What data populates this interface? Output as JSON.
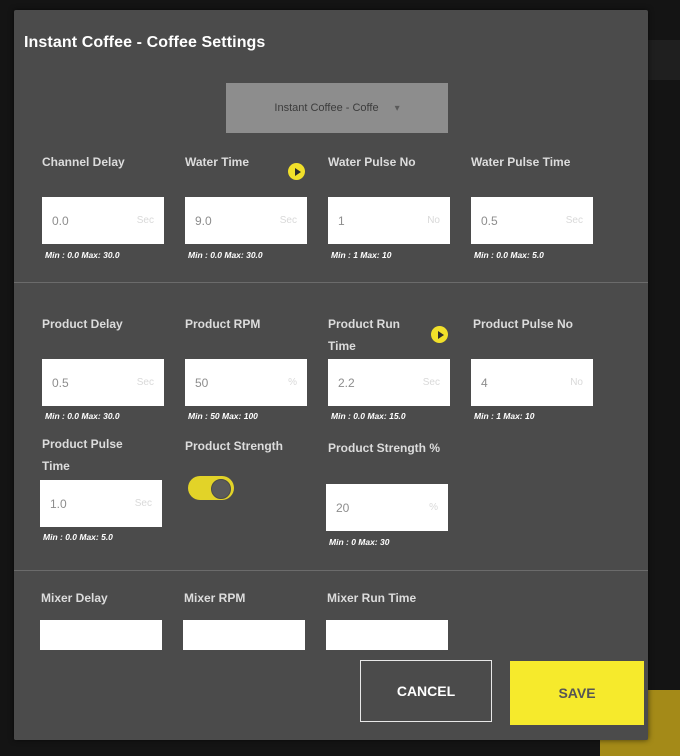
{
  "dialog": {
    "title": "Instant Coffee - Coffee Settings",
    "select_value": "Instant Coffee - Coffe"
  },
  "fields": {
    "channel_delay": {
      "label": "Channel Delay",
      "value": "0.0",
      "unit": "Sec",
      "range": "Min : 0.0 Max: 30.0"
    },
    "water_time": {
      "label": "Water Time",
      "value": "9.0",
      "unit": "Sec",
      "range": "Min : 0.0 Max: 30.0"
    },
    "water_pulse_no": {
      "label": "Water Pulse No",
      "value": "1",
      "unit": "No",
      "range": "Min : 1 Max: 10"
    },
    "water_pulse_time": {
      "label": "Water Pulse Time",
      "value": "0.5",
      "unit": "Sec",
      "range": "Min : 0.0 Max: 5.0"
    },
    "product_delay": {
      "label": "Product Delay",
      "value": "0.5",
      "unit": "Sec",
      "range": "Min : 0.0 Max: 30.0"
    },
    "product_rpm": {
      "label": "Product RPM",
      "value": "50",
      "unit": "%",
      "range": "Min : 50 Max: 100"
    },
    "product_run_time": {
      "label": "Product Run Time",
      "value": "2.2",
      "unit": "Sec",
      "range": "Min : 0.0 Max: 15.0"
    },
    "product_pulse_no": {
      "label": "Product Pulse No",
      "value": "4",
      "unit": "No",
      "range": "Min : 1 Max: 10"
    },
    "product_pulse_time": {
      "label": "Product Pulse Time",
      "value": "1.0",
      "unit": "Sec",
      "range": "Min : 0.0 Max: 5.0"
    },
    "product_strength": {
      "label": "Product Strength",
      "enabled": true
    },
    "product_strength_pct": {
      "label": "Product Strength %",
      "value": "20",
      "unit": "%",
      "range": "Min : 0 Max: 30"
    },
    "mixer_delay": {
      "label": "Mixer Delay"
    },
    "mixer_rpm": {
      "label": "Mixer RPM"
    },
    "mixer_run_time": {
      "label": "Mixer Run Time"
    }
  },
  "buttons": {
    "cancel": "CANCEL",
    "save": "SAVE"
  },
  "colors": {
    "dialog_bg": "#4b4b4b",
    "accent_yellow": "#f6ea2c",
    "select_bg": "#8d8d8d"
  },
  "icons": {
    "play": "play-circle-icon",
    "dropdown": "chevron-down-icon"
  }
}
